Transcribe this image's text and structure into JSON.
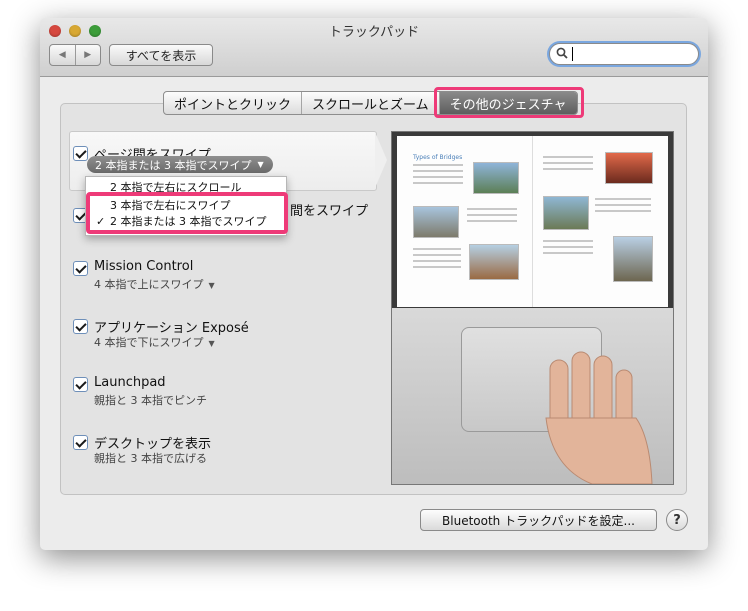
{
  "window": {
    "title": "トラックパッド"
  },
  "toolbar": {
    "back_glyph": "◀",
    "forward_glyph": "▶",
    "show_all_label": "すべてを表示",
    "search_value": "",
    "search_placeholder": ""
  },
  "tabs": [
    {
      "label": "ポイントとクリック",
      "active": false
    },
    {
      "label": "スクロールとズーム",
      "active": false
    },
    {
      "label": "その他のジェスチャ",
      "active": true
    }
  ],
  "gestures": [
    {
      "title": "ページ間をスワイプ",
      "subtitle": "2 本指または 3 本指でスワイプ",
      "checked": true,
      "selected": true
    },
    {
      "title": "間をスワイプ",
      "subtitle": "",
      "checked": true
    },
    {
      "title": "Mission Control",
      "subtitle": "4 本指で上にスワイプ",
      "checked": true,
      "has_menu": true
    },
    {
      "title": "アプリケーション Exposé",
      "subtitle": "4 本指で下にスワイプ",
      "checked": true,
      "has_menu": true
    },
    {
      "title": "Launchpad",
      "subtitle": "親指と 3 本指でピンチ",
      "checked": true
    },
    {
      "title": "デスクトップを表示",
      "subtitle": "親指と 3 本指で広げる",
      "checked": true
    }
  ],
  "popup_menu": {
    "items": [
      {
        "label": "2 本指で左右にスクロール",
        "checked": false
      },
      {
        "label": "3 本指で左右にスワイプ",
        "checked": false
      },
      {
        "label": "2 本指または 3 本指でスワイプ",
        "checked": true
      }
    ],
    "check_glyph": "✓",
    "arrow_glyph": "▼"
  },
  "preview": {
    "book_heading": "Types of Bridges"
  },
  "footer": {
    "bluetooth_button_label": "Bluetooth トラックパッドを設定...",
    "help_label": "?"
  },
  "colors": {
    "highlight": "#ee3a78",
    "active_tab": "#6e6e6e",
    "close": "#d6483f",
    "minimize": "#d8a833",
    "maximize": "#3d9d3a"
  }
}
